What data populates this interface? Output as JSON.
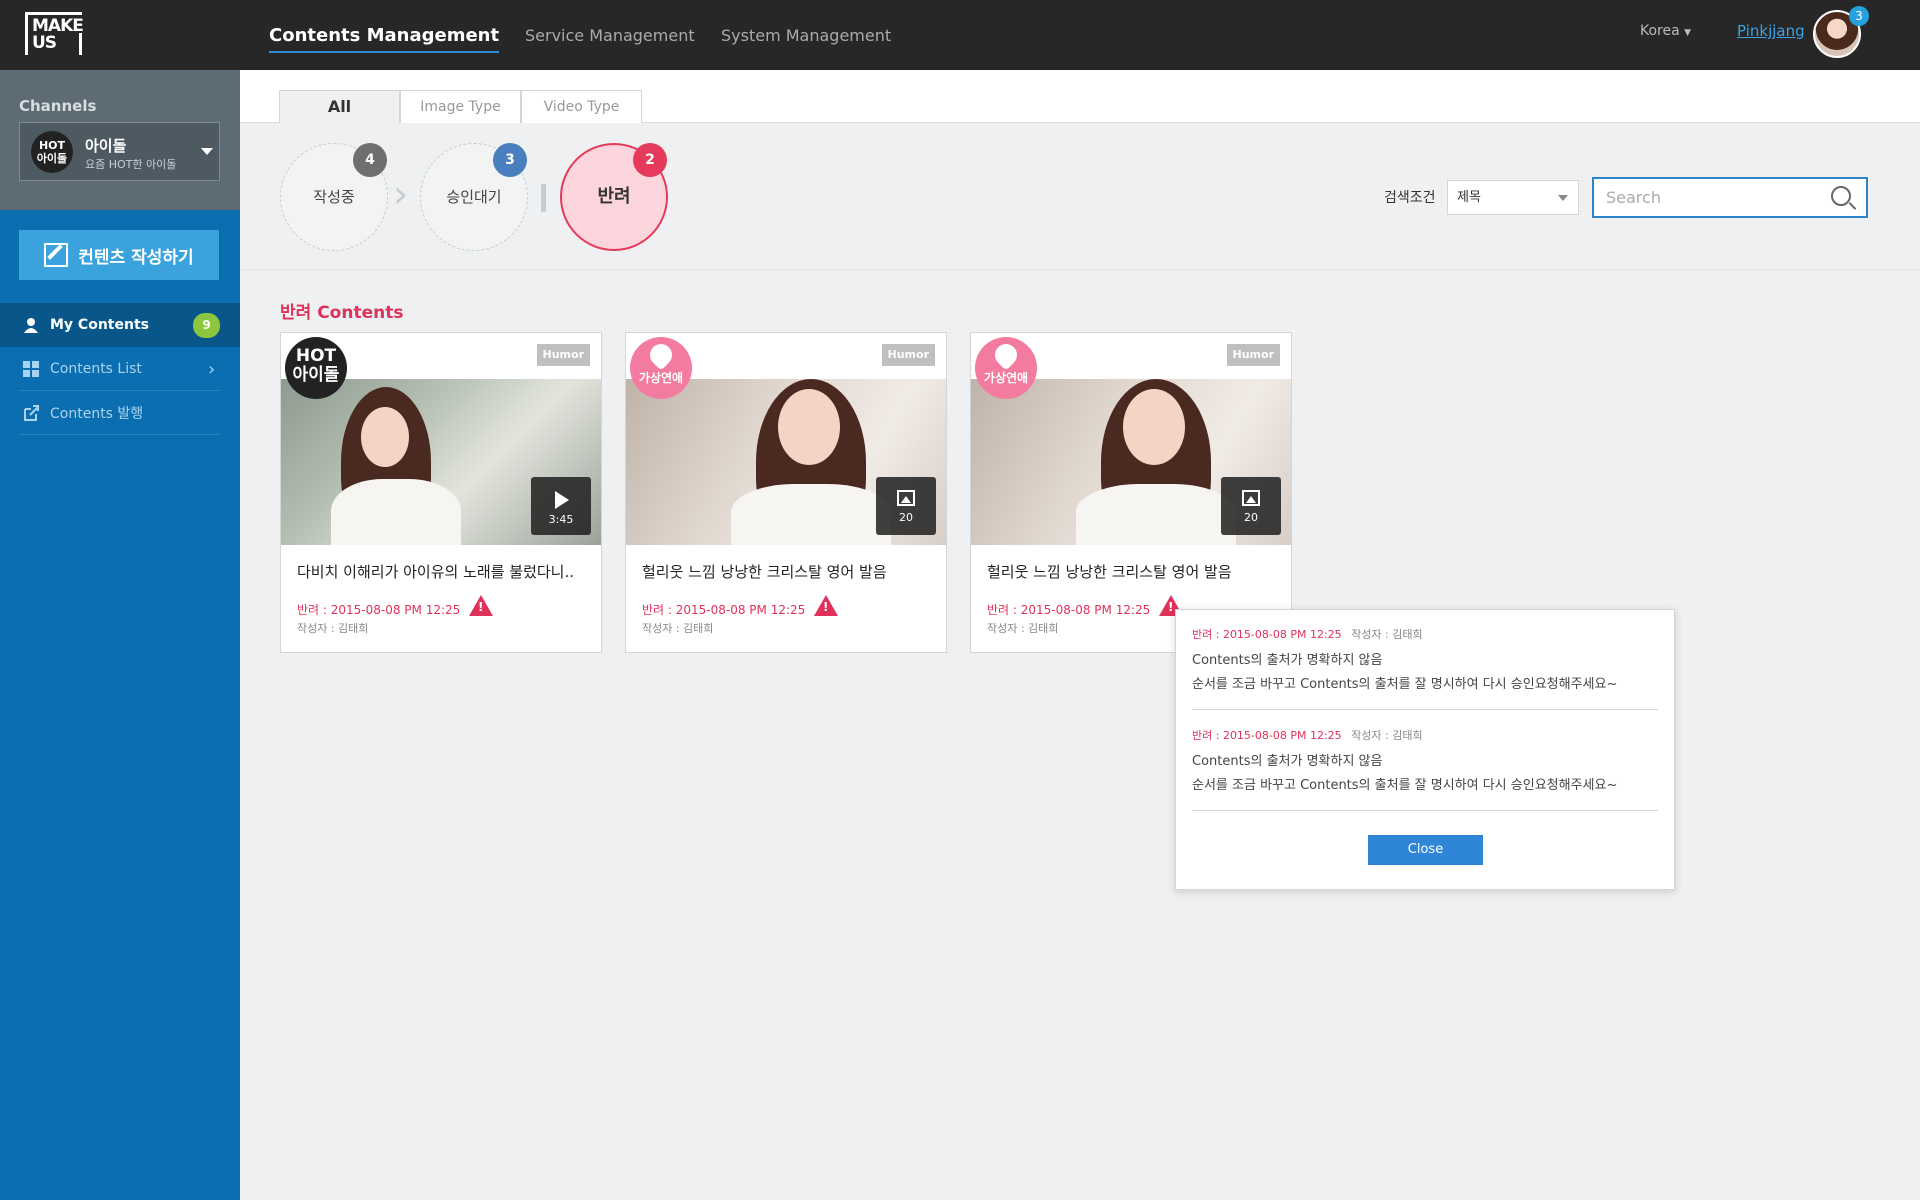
{
  "header": {
    "logo_line1": "MAKE",
    "logo_line2": "US",
    "nav": [
      "Contents Management",
      "Service Management",
      "System Management"
    ],
    "region": "Korea",
    "username": "Pinkjjang",
    "notification_count": "3"
  },
  "sidebar": {
    "channels_label": "Channels",
    "channel": {
      "logo_line1": "HOT",
      "logo_line2": "아이돌",
      "name": "아이돌",
      "sub": "요즘 HOT한 아이돌"
    },
    "write_button": "컨텐츠 작성하기",
    "menu": [
      {
        "label": "My Contents",
        "badge": "9"
      },
      {
        "label": "Contents List"
      },
      {
        "label": "Contents 발행"
      }
    ]
  },
  "tabs": [
    "All",
    "Image Type",
    "Video Type"
  ],
  "status_filters": [
    {
      "label": "작성중",
      "count": "4",
      "color": "#6f6f6f"
    },
    {
      "label": "승인대기",
      "count": "3",
      "color": "#4a7fbf"
    },
    {
      "label": "반려",
      "count": "2",
      "color": "#e53a5b"
    }
  ],
  "search": {
    "condition_label": "검색조건",
    "condition_value": "제목",
    "placeholder": "Search"
  },
  "section_title": "반려 Contents",
  "cards": [
    {
      "channel_badge": [
        "HOT",
        "아이돌"
      ],
      "tag": "Humor",
      "media_type": "video",
      "media_value": "3:45",
      "title": "다비치 이해리가 아이유의 노래를 불렀다니..",
      "reject": "반려 : 2015-08-08 PM 12:25",
      "author": "작성자 : 김태희"
    },
    {
      "channel_badge": [
        "가상연애"
      ],
      "tag": "Humor",
      "media_type": "image",
      "media_value": "20",
      "title": "헐리웃 느낌 낭낭한 크리스탈 영어 발음",
      "reject": "반려 : 2015-08-08 PM 12:25",
      "author": "작성자 : 김태희"
    },
    {
      "channel_badge": [
        "가상연애"
      ],
      "tag": "Humor",
      "media_type": "image",
      "media_value": "20",
      "title": "헐리웃 느낌 낭낭한 크리스탈 영어 발음",
      "reject": "반려 : 2015-08-08 PM 12:25",
      "author": "작성자 : 김태희"
    }
  ],
  "popup": {
    "entries": [
      {
        "meta": "반려 : 2015-08-08 PM 12:25",
        "author": "작성자 : 김태희",
        "line1": "Contents의 출처가 명확하지 않음",
        "line2": "순서를 조금 바꾸고 Contents의 출처를 잘 명시하여 다시 승인요청해주세요~"
      },
      {
        "meta": "반려 : 2015-08-08 PM 12:25",
        "author": "작성자 : 김태희",
        "line1": "Contents의 출처가 명확하지 않음",
        "line2": "순서를 조금 바꾸고 Contents의 출처를 잘 명시하여 다시 승인요청해주세요~"
      }
    ],
    "close_label": "Close"
  },
  "colors": {
    "accent_blue": "#0b6eb0",
    "reject_red": "#e0315a",
    "badge_green": "#8cc63f"
  }
}
